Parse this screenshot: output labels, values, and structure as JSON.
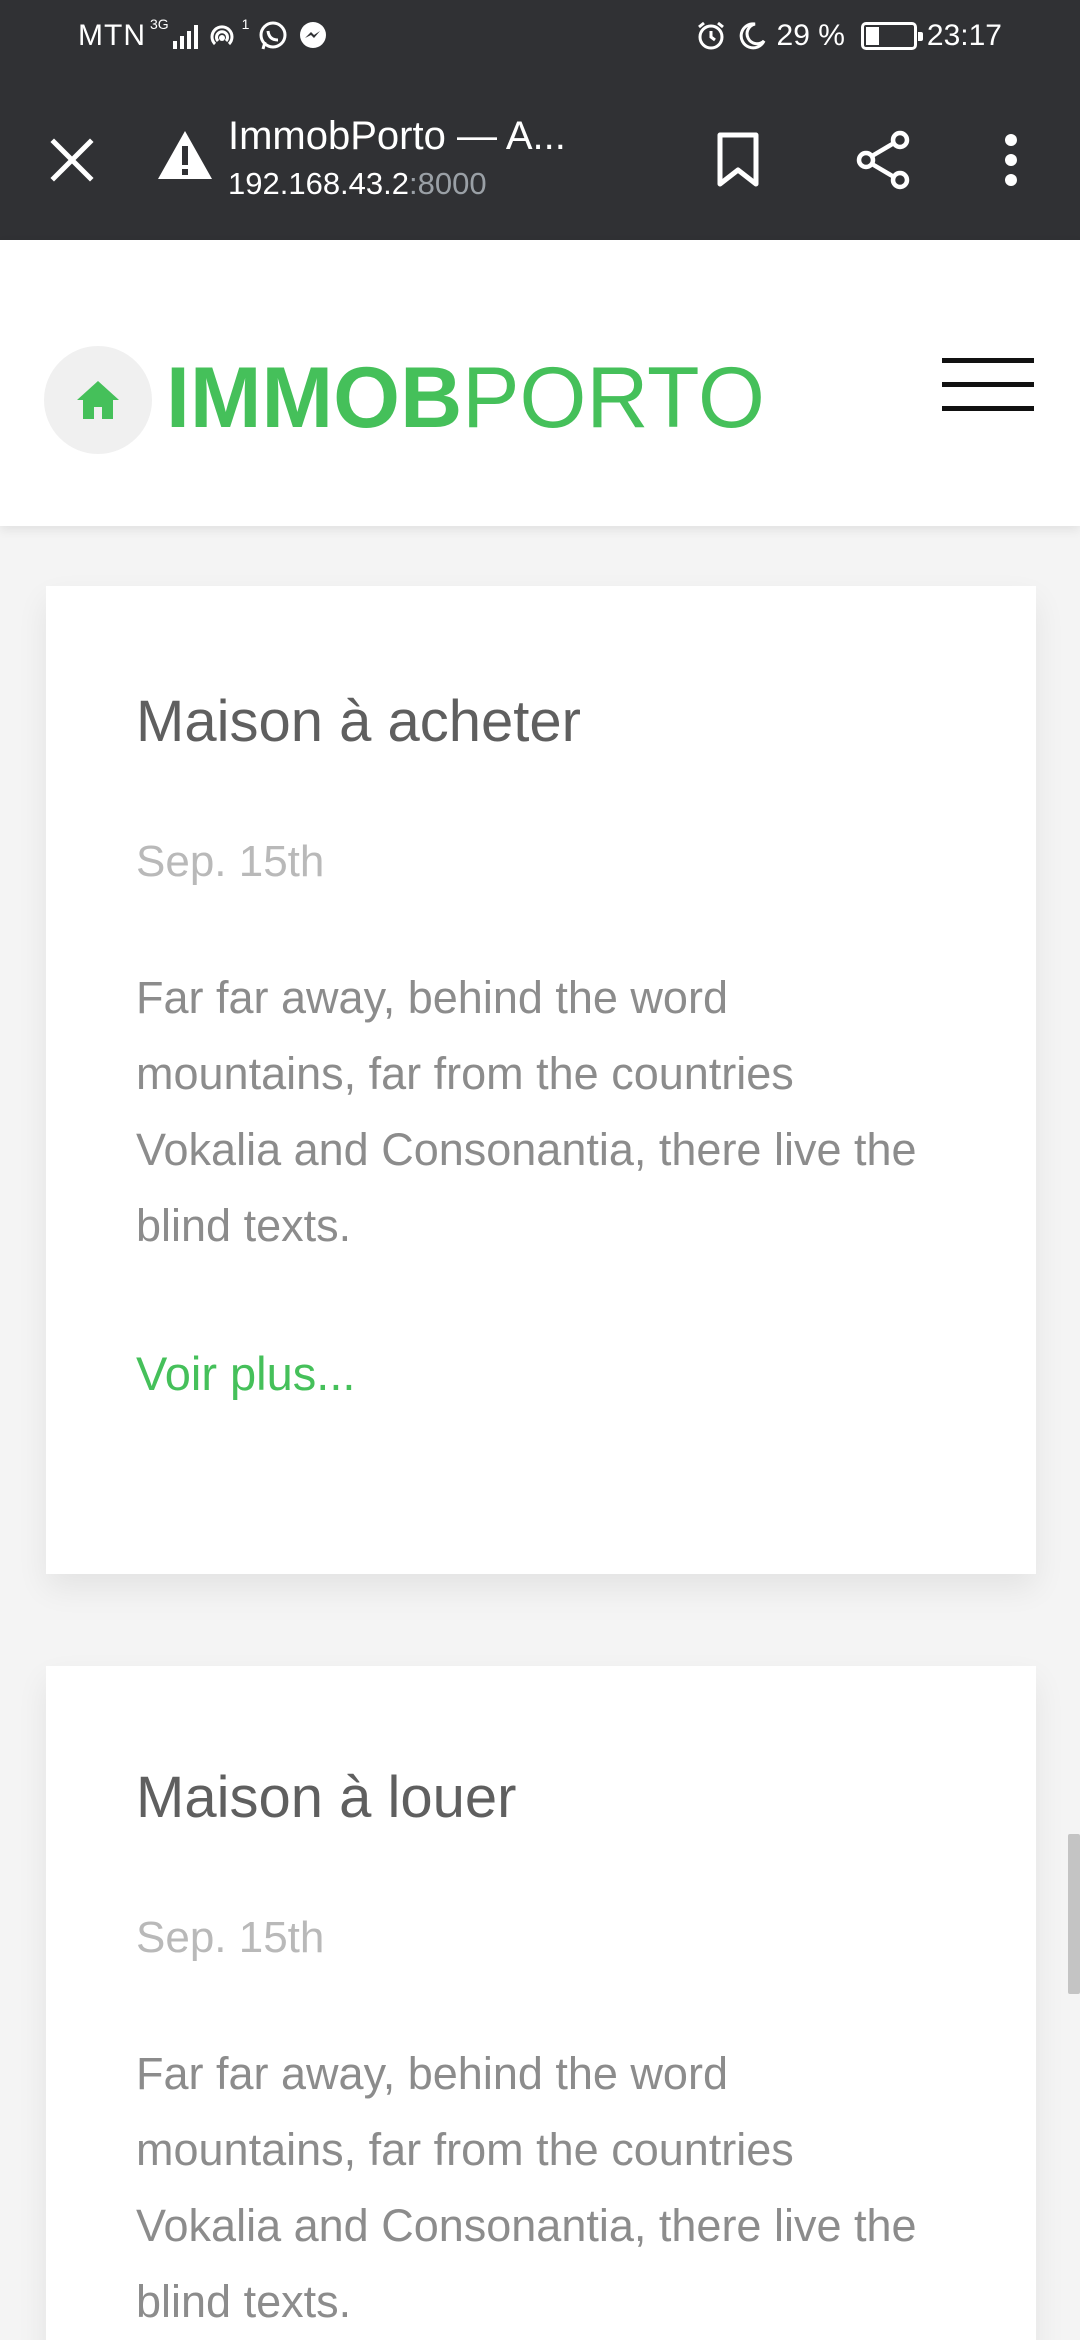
{
  "status_bar": {
    "carrier": "MTN",
    "network_type": "3G",
    "hotspot_count": "1",
    "battery": "29 %",
    "time": "23:17",
    "battery_level": 0.29
  },
  "browser": {
    "page_title": "ImmobPorto — A...",
    "url_host": "192.168.43.2",
    "url_port": ":8000"
  },
  "site": {
    "logo_bold": "IMMOB",
    "logo_light": "PORTO",
    "brand_color": "#45c05a"
  },
  "posts": [
    {
      "title": "Maison à acheter",
      "date": "Sep. 15th",
      "excerpt": "Far far away, behind the word mountains, far from the countries Vokalia and Consonantia, there live the blind texts.",
      "link": "Voir plus..."
    },
    {
      "title": "Maison à louer",
      "date": "Sep. 15th",
      "excerpt": "Far far away, behind the word mountains, far from the countries Vokalia and Consonantia, there live the blind texts."
    }
  ]
}
